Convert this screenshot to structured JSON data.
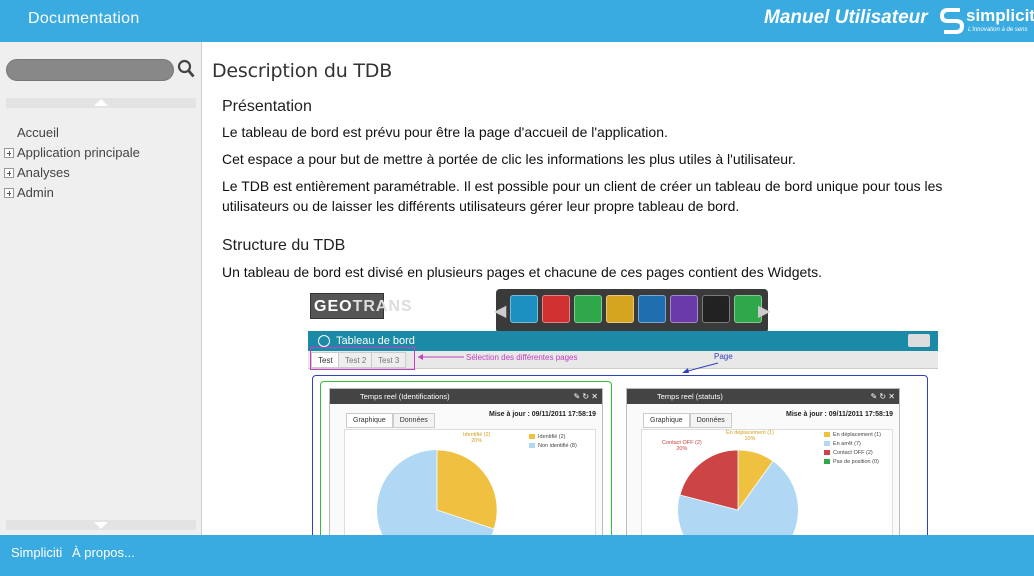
{
  "header": {
    "doc_label": "Documentation",
    "manual_title": "Manuel Utilisateur",
    "brand_name": "simpliciti",
    "brand_tagline": "L'innovation à de sens",
    "bg_color": "#3aabe0"
  },
  "sidebar": {
    "search": {
      "value": "",
      "placeholder": ""
    },
    "items": [
      {
        "label": "Accueil",
        "expandable": false
      },
      {
        "label": "Application principale",
        "expandable": true
      },
      {
        "label": "Analyses",
        "expandable": true
      },
      {
        "label": "Admin",
        "expandable": true
      }
    ]
  },
  "main": {
    "page_title": "Description du TDB",
    "sections": [
      {
        "title": "Présentation",
        "paragraphs": [
          "Le tableau de bord est prévu pour être la page d'accueil de l'application.",
          "Cet espace a pour but de mettre à portée de clic les informations les plus utiles à l'utilisateur.",
          "Le TDB est entièrement paramétrable. Il est possible pour un client de créer un tableau de bord unique pour tous les utilisateurs ou de laisser les différents utilisateurs gérer leur propre tableau de bord."
        ]
      },
      {
        "title": "Structure du TDB",
        "paragraphs": [
          "Un tableau de bord est divisé en plusieurs pages et chacune de ces pages contient des Widgets."
        ]
      }
    ],
    "figure": {
      "logo_geo": "GEO",
      "logo_trans": "TRANS",
      "dock_icon_colors": [
        "#1b8fc0",
        "#d03030",
        "#2ea84a",
        "#d6a520",
        "#1f6fb0",
        "#6a3aa8",
        "#222222",
        "#2ea84a"
      ],
      "dock_icons": [
        "gauge-icon",
        "clock-icon",
        "network-icon",
        "upload-icon",
        "mail-icon",
        "history-icon",
        "user-icon",
        "chart-icon"
      ],
      "header_title": "Tableau de bord",
      "tabs": [
        "Test",
        "Test 2",
        "Test 3"
      ],
      "annotation_pages": "Sélection des différentes pages",
      "annotation_page": "Page",
      "widgets": [
        {
          "title": "Temps reel (Identifications)",
          "tabs": [
            "Graphique",
            "Données"
          ],
          "updated": "Mise à jour : 09/11/2011 17:58:19",
          "slice_label": "Identifié (2)",
          "slice_pct": "20%",
          "legend": [
            {
              "label": "Identifié (2)",
              "color": "#f0c040"
            },
            {
              "label": "Non identifié (8)",
              "color": "#b0d8f4"
            }
          ]
        },
        {
          "title": "Temps reel (statuts)",
          "tabs": [
            "Graphique",
            "Données"
          ],
          "updated": "Mise à jour : 09/11/2011 17:58:19",
          "slice_label_a": "En déplacement (1)",
          "slice_pct_a": "10%",
          "slice_label_b": "Contact OFF (2)",
          "slice_pct_b": "20%",
          "legend": [
            {
              "label": "En déplacement (1)",
              "color": "#f0c040"
            },
            {
              "label": "En arrêt (7)",
              "color": "#b0d8f4"
            },
            {
              "label": "Contact OFF (2)",
              "color": "#cc4444"
            },
            {
              "label": "Pas de position (0)",
              "color": "#2ea84a"
            }
          ]
        }
      ]
    }
  },
  "footer": {
    "link_simpliciti": "Simpliciti",
    "link_about": "À propos..."
  }
}
